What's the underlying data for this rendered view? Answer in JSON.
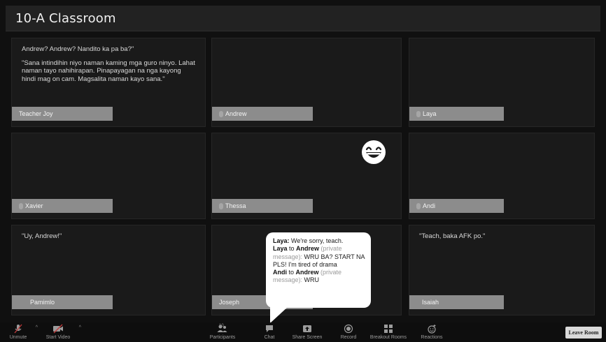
{
  "window": {
    "title": "10-A Classroom"
  },
  "tiles": [
    {
      "name": "Teacher Joy",
      "speech": [
        "Andrew? Andrew? Nandito ka pa ba?\"",
        "\"Sana intindihin niyo naman kaming mga guro ninyo. Lahat naman tayo nahihirapan. Pinapayagan na nga kayong hindi mag on cam. Magsalita naman kayo sana.\""
      ]
    },
    {
      "name": "Andrew",
      "speech": []
    },
    {
      "name": "Laya",
      "speech": []
    },
    {
      "name": "Xavier",
      "speech": []
    },
    {
      "name": "Thessa",
      "speech": []
    },
    {
      "name": "Andi",
      "speech": []
    },
    {
      "name": "Pamimlo",
      "speech": [
        "\"Uy, Andrew!\""
      ]
    },
    {
      "name": "Joseph",
      "speech": []
    },
    {
      "name": "Isaiah",
      "speech": [
        "\"Teach, baka AFK po.\""
      ]
    }
  ],
  "chat_bubble": {
    "line1_name": "Laya:",
    "line1_text": " We're sorry, teach.",
    "line2_from": "Laya",
    "line2_to_word": " to ",
    "line2_to": "Andrew",
    "line2_pm": " (private message):",
    "line2_text": " WRU BA?  START NA PLS! I'm tired of drama",
    "line3_from": "Andi",
    "line3_to_word": " to  ",
    "line3_to": "Andrew",
    "line3_pm": " (private message):",
    "line3_text": " WRU"
  },
  "reaction": {
    "icon": "laughing-emoji-icon"
  },
  "toolbar": {
    "unmute": "Unmute",
    "start_video": "Start Video",
    "participants": "Participants",
    "participants_count": "10",
    "chat": "Chat",
    "share_screen": "Share Screen",
    "record": "Record",
    "breakout_rooms": "Breakout Rooms",
    "reactions": "Reactions",
    "leave_room": "Leave Room"
  },
  "colors": {
    "nameplate": "#8c8c8c",
    "tile_bg": "#1a1a1a",
    "bubble_bg": "#ffffff"
  }
}
